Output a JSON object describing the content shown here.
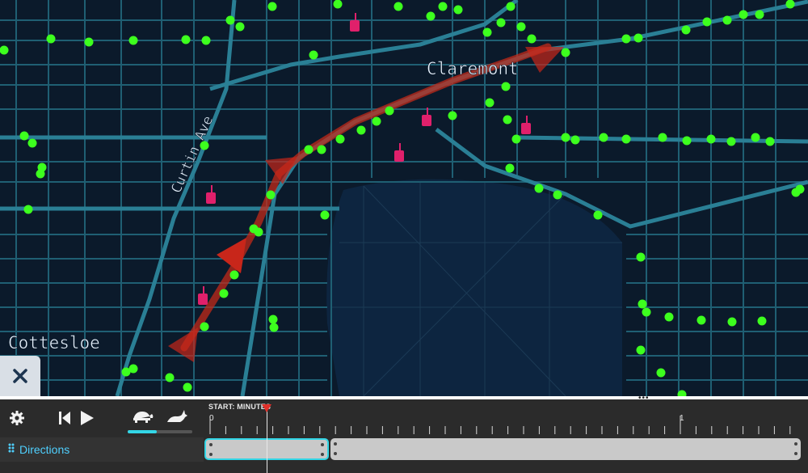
{
  "map": {
    "labels": {
      "claremont": "Claremont",
      "cottesloe": "Cottesloe",
      "curtin_ave": "Curtin Ave"
    },
    "colors": {
      "background": "#0b1a2b",
      "roads": "#1f5f73",
      "major_roads": "#2a7f95",
      "route": "#c22a1a",
      "points": "#3dff1e",
      "markers": "#e0206b"
    }
  },
  "close_button": {
    "icon": "close-icon"
  },
  "toolbar": {
    "settings_icon": "gear-icon",
    "skip_back_icon": "skip-back-icon",
    "play_icon": "play-icon",
    "slow_icon": "turtle-icon",
    "fast_icon": "rabbit-icon",
    "speed_level": 0.45
  },
  "track": {
    "drag_icon": "drag-handle-icon",
    "label": "Directions"
  },
  "timeline": {
    "start_label": "START: MINUTES",
    "tick_labels": [
      "0",
      "1"
    ],
    "playhead_minutes": 0.12,
    "accent": "#33d6e6"
  }
}
